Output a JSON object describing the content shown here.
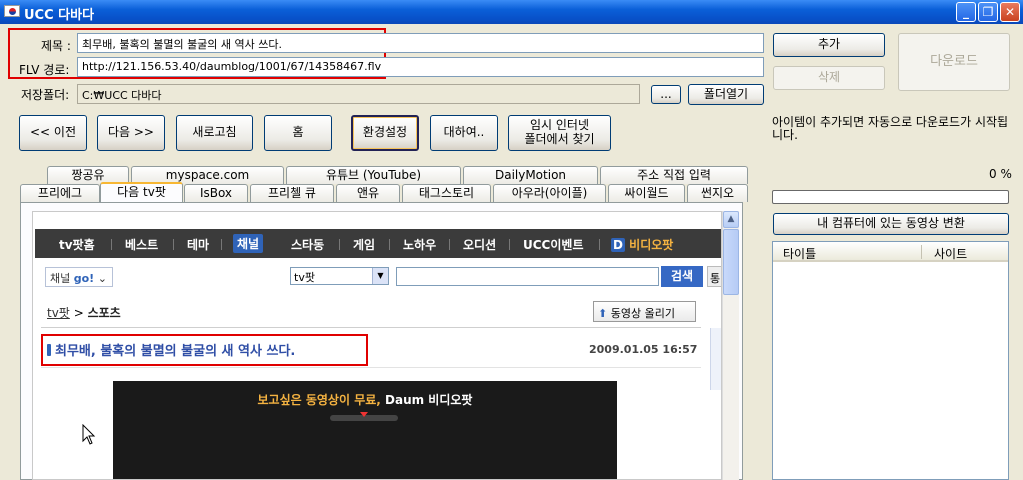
{
  "window": {
    "title": "UCC 다바다",
    "minimize": "_",
    "restore": "❐",
    "close": "✕"
  },
  "form": {
    "title_label": "제목 :",
    "title_value": "최무배, 불혹의 불멸의 불굴의 새 역사 쓰다.",
    "flv_label": "FLV 경로:",
    "flv_value": "http://121.156.53.40/daumblog/1001/67/14358467.flv",
    "folder_label": "저장폴더:",
    "folder_value": "C:₩UCC 다바다",
    "browse_label": "...",
    "open_folder_label": "폴더열기",
    "add_label": "추가",
    "delete_label": "삭제",
    "download_label": "다운로드"
  },
  "nav_buttons": {
    "prev": "<< 이전",
    "next": "다음 >>",
    "refresh": "새로고침",
    "home": "홈",
    "settings": "환경설정",
    "about": "대하여..",
    "temp_line1": "임시 인터넷",
    "temp_line2": "폴더에서 찾기"
  },
  "tabs_row1": [
    "짱공유",
    "myspace.com",
    "유튜브 (YouTube)",
    "DailyMotion",
    "주소 직접 입력"
  ],
  "tabs_row2": [
    "프리에그",
    "다음 tv팟",
    "IsBox",
    "프리첼 큐",
    "앤유",
    "태그스토리",
    "아우라(아이플)",
    "싸이월드",
    "썬지오"
  ],
  "webpage": {
    "nav": [
      "tv팟홈",
      "베스트",
      "테마",
      "채널",
      "스타동",
      "게임",
      "노하우",
      "오디션",
      "UCC이벤트",
      "비디오팟"
    ],
    "nav_d_logo": "D",
    "channel_go": "채널",
    "channel_go_b": "go!",
    "channel_arrow": "⌄",
    "search_scope": "tv팟",
    "search_button": "검색",
    "search_button2": "통",
    "crumb_home": "tv팟",
    "crumb_sep": ">",
    "crumb_current": "스포츠",
    "upload_icon": "⬆",
    "upload_label": "동영상 올리기",
    "post_title": "최무배, 불혹의 불멸의 불굴의 새 역사 쓰다.",
    "post_date": "2009.01.05 16:57",
    "video_banner_a": "보고싶은 동영상이 무료,",
    "video_banner_b": " Daum 비디오팟"
  },
  "right_panel": {
    "info": "아이템이 추가되면 자동으로 다운로드가 시작됩니다.",
    "percent": "0 %",
    "progress": 0,
    "convert_label": "내 컴퓨터에 있는 동영상 변환",
    "col_title": "타이틀",
    "col_site": "사이트"
  }
}
